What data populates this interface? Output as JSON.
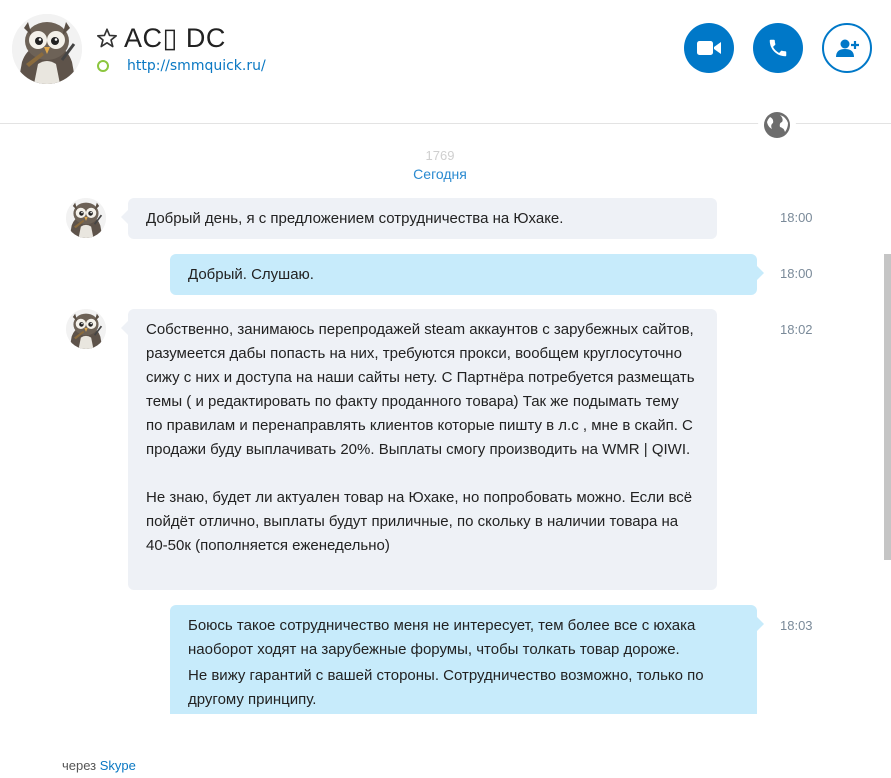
{
  "header": {
    "contact_name": "AC▯ DC",
    "mood_url": "http://smmquick.ru/",
    "avatar": "owl-avatar",
    "favorite_icon": "star-outline-icon",
    "presence": "status-ring",
    "buttons": {
      "video": "video-call-icon",
      "audio": "phone-icon",
      "add": "add-contact-icon"
    }
  },
  "chat": {
    "faded_number": "1769",
    "date_separator": "Сегодня",
    "messages": [
      {
        "direction": "incoming",
        "time": "18:00",
        "paragraphs": [
          "Добрый день, я с предложением сотрудничества на Юхаке."
        ]
      },
      {
        "direction": "outgoing",
        "time": "18:00",
        "paragraphs": [
          "Добрый. Слушаю."
        ]
      },
      {
        "direction": "incoming",
        "time": "18:02",
        "paragraphs": [
          "Собственно, занимаюсь перепродажей steam аккаунтов с зарубежных сайтов, разумеется дабы попасть на них, требуются прокси, вообщем круглосуточно сижу с них и доступа на наши сайты нету. С Партнёра потребуется размещать темы ( и редактировать по факту проданного товара) Так же подымать тему по правилам и перенаправлять клиентов которые пишту в л.с , мне в скайп. С продажи буду выплачивать 20%. Выплаты смогу производить на WMR | QIWI.",
          "Не знаю, будет ли актуален товар на Юхаке, но попробовать можно. Если всё пойдёт отлично, выплаты будут приличные, по скольку в наличии товара на 40-50к (пополняется еженедельно)"
        ]
      },
      {
        "direction": "outgoing",
        "time": "18:03",
        "paragraphs": [
          "Боюсь такое сотрудничество меня не интересует, тем более все с юхака наоборот ходят на зарубежные форумы, чтобы толкать товар дороже.",
          "Не вижу гарантий с вашей стороны. Сотрудничество возможно, только по другому принципу."
        ]
      }
    ]
  },
  "footer": {
    "via_label": "через",
    "via_link": "Skype"
  },
  "colors": {
    "accent": "#0078c8",
    "incoming_bubble": "#eef1f6",
    "outgoing_bubble": "#c7ebfb",
    "presence_ring": "#8cc63f",
    "link": "#0a78c3"
  }
}
